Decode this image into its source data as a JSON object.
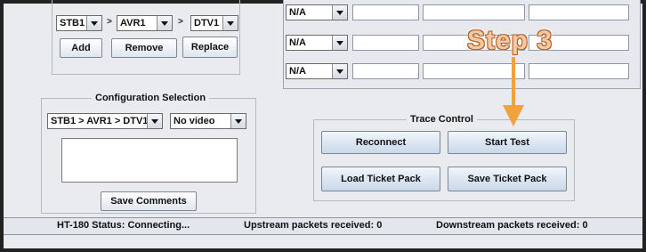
{
  "chain_selector": {
    "combos": [
      {
        "value": "STB1"
      },
      {
        "value": "AVR1"
      },
      {
        "value": "DTV1"
      }
    ],
    "separator": ">",
    "buttons": {
      "add": "Add",
      "remove": "Remove",
      "replace": "Replace"
    }
  },
  "mapping_rows": [
    {
      "value": "N/A"
    },
    {
      "value": "N/A"
    },
    {
      "value": "N/A"
    }
  ],
  "configuration": {
    "title": "Configuration Selection",
    "config_value": "STB1 > AVR1 > DTV1",
    "video_value": "No video",
    "comments_value": "",
    "save_label": "Save Comments"
  },
  "trace": {
    "title": "Trace Control",
    "reconnect": "Reconnect",
    "start": "Start Test",
    "load": "Load Ticket Pack",
    "save": "Save Ticket Pack"
  },
  "annotation": {
    "label": "Step 3",
    "color": "#f0a33b"
  },
  "status": {
    "ht": "HT-180 Status: Connecting...",
    "upstream": "Upstream packets received: 0",
    "downstream": "Downstream packets received: 0"
  }
}
